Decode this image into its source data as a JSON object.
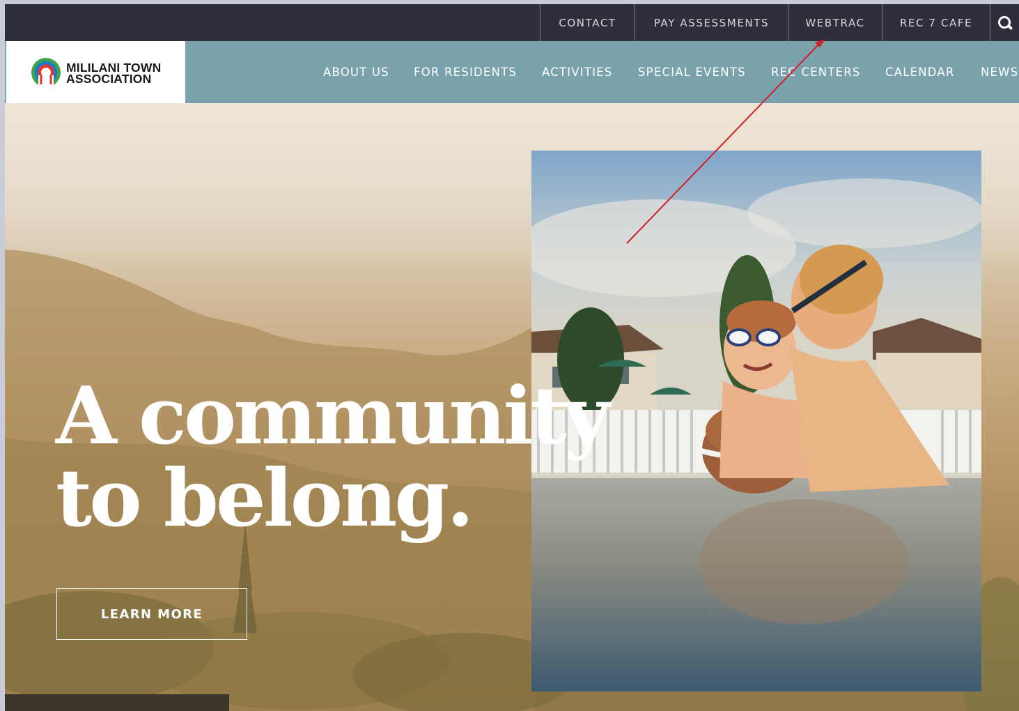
{
  "utility_nav": {
    "contact": "CONTACT",
    "pay_assessments": "PAY ASSESSMENTS",
    "webtrac": "WEBTRAC",
    "rec7_cafe": "REC 7 CAFE"
  },
  "logo": {
    "line1": "MILILANI TOWN",
    "line2": "ASSOCIATION"
  },
  "main_nav": {
    "items": [
      "ABOUT US",
      "FOR RESIDENTS",
      "ACTIVITIES",
      "SPECIAL EVENTS",
      "REC CENTERS",
      "CALENDAR",
      "NEWS"
    ]
  },
  "hero": {
    "headline_line1": "A community",
    "headline_line2": "to belong.",
    "cta_label": "LEARN MORE"
  },
  "icons": {
    "search": "search-icon",
    "logo": "mta-rainbow-logo-icon"
  },
  "colors": {
    "utility_bar": "#2f2f3b",
    "main_nav": "#7aa2ad",
    "annotation_arrow": "#d0202a"
  }
}
